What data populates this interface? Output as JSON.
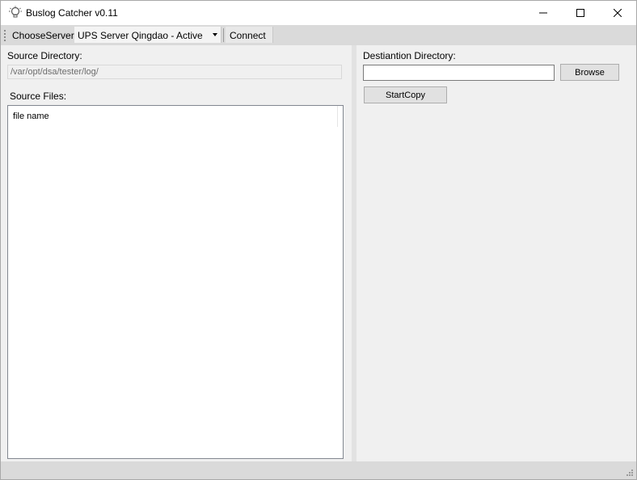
{
  "window": {
    "title": "Buslog Catcher v0.11",
    "icons": {
      "app": "bulb-icon",
      "minimize": "minimize-icon",
      "maximize": "maximize-icon",
      "close": "close-icon"
    }
  },
  "toolbar": {
    "choose_server_label": "ChooseServer",
    "server_selected": "UPS Server Qingdao - Active",
    "connect_label": "Connect",
    "icons": {
      "grip": "grip-dots-icon",
      "dropdown": "dropdown-arrow-icon"
    }
  },
  "source": {
    "directory_label": "Source Directory:",
    "directory_value": "/var/opt/dsa/tester/log/",
    "files_label": "Source Files:",
    "columns": [
      "file name"
    ],
    "rows": []
  },
  "destination": {
    "directory_label": "Destiantion Directory:",
    "directory_value": "",
    "browse_label": "Browse",
    "start_copy_label": "StartCopy"
  },
  "status_bar": {
    "icons": {
      "resize": "size-grip-icon"
    }
  },
  "colors": {
    "window_bg": "#f0f0f0",
    "toolbar_bg": "#dadada",
    "button_bg": "#e1e1e1",
    "border": "#828790"
  }
}
